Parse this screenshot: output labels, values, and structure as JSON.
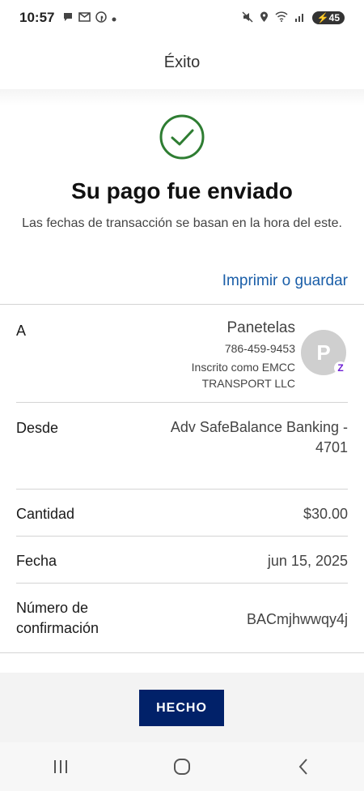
{
  "status_bar": {
    "time": "10:57",
    "battery": "45"
  },
  "title_bar": {
    "title": "Éxito"
  },
  "confirmation": {
    "headline": "Su pago fue enviado",
    "subtext": "Las fechas de transacción se basan en la hora del este.",
    "print_link": "Imprimir o guardar"
  },
  "details": {
    "to": {
      "label": "A",
      "name": "Panetelas",
      "phone": "786-459-9453",
      "registered": "Inscrito como EMCC TRANSPORT LLC",
      "avatar_letter": "P"
    },
    "from": {
      "label": "Desde",
      "value": "Adv SafeBalance Banking - 4701"
    },
    "amount": {
      "label": "Cantidad",
      "value": "$30.00"
    },
    "date": {
      "label": "Fecha",
      "value": "jun 15, 2025"
    },
    "confirmation_number": {
      "label": "Número de confirmación",
      "value": "BACmjhwwqy4j"
    }
  },
  "footer": {
    "done_label": "HECHO"
  },
  "colors": {
    "success_green": "#2e7d32",
    "link_blue": "#1a5ea8",
    "button_navy": "#012169",
    "zelle_purple": "#6d1ed4"
  }
}
